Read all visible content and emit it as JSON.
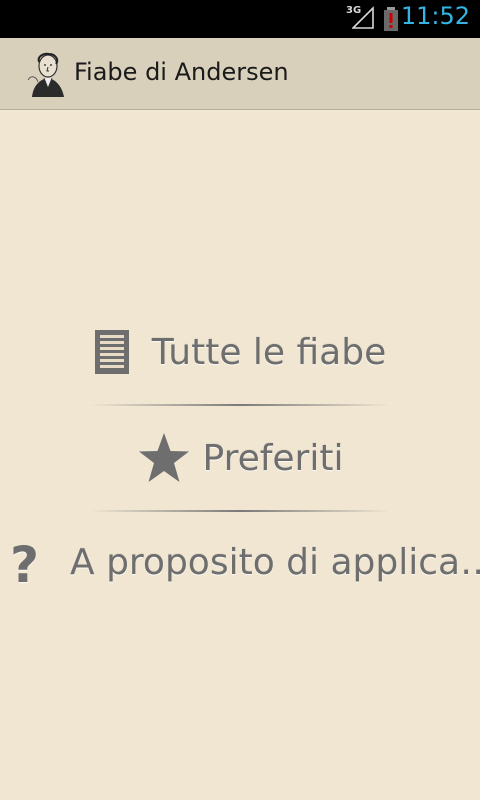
{
  "status_bar": {
    "network_type": "3G",
    "time": "11:52",
    "battery_alert_color": "#cc0000",
    "clock_color": "#33b5e5"
  },
  "action_bar": {
    "title": "Fiabe di Andersen",
    "icon": "andersen-portrait-icon"
  },
  "menu": {
    "items": [
      {
        "label": "Tutte le fiabe",
        "icon": "list-document-icon"
      },
      {
        "label": "Preferiti",
        "icon": "star-icon"
      },
      {
        "label": "A proposito di applica…",
        "icon": "question-icon",
        "icon_text": "?"
      }
    ]
  },
  "colors": {
    "background": "#f0e6d2",
    "action_bar": "#d9d0bc",
    "menu_text": "#6e6e6e"
  }
}
